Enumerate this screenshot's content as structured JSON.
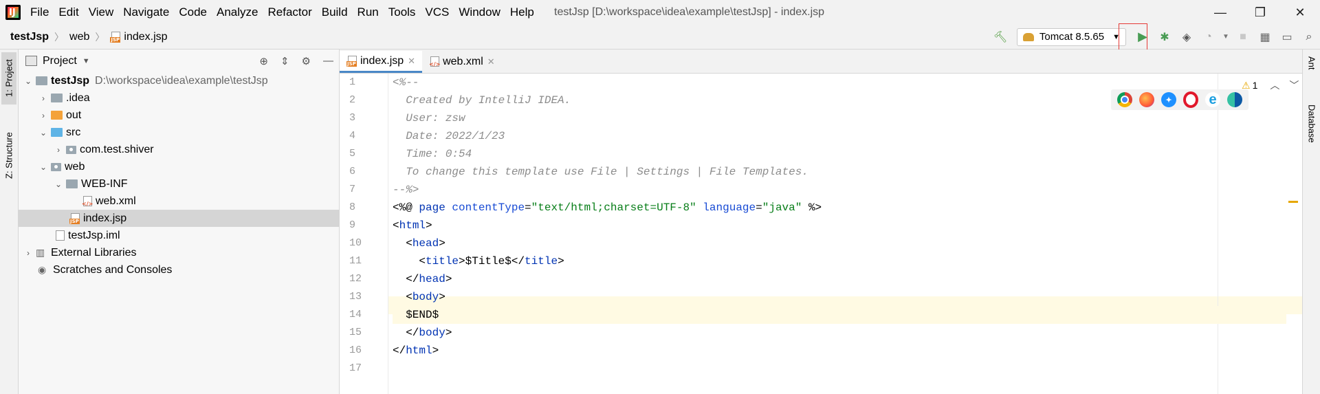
{
  "menubar": {
    "items": [
      "File",
      "Edit",
      "View",
      "Navigate",
      "Code",
      "Analyze",
      "Refactor",
      "Build",
      "Run",
      "Tools",
      "VCS",
      "Window",
      "Help"
    ],
    "window_title": "testJsp [D:\\workspace\\idea\\example\\testJsp] - index.jsp"
  },
  "navbar": {
    "breadcrumbs": [
      "testJsp",
      "web",
      "index.jsp"
    ],
    "run_config": "Tomcat 8.5.65"
  },
  "left_stripe": {
    "project_tab": "1: Project",
    "structure_tab": "Z: Structure"
  },
  "right_stripe": {
    "ant_tab": "Ant",
    "database_tab": "Database"
  },
  "project_panel": {
    "title": "Project",
    "tree": [
      {
        "label": "testJsp",
        "path": "D:\\workspace\\idea\\example\\testJsp"
      },
      {
        "label": ".idea"
      },
      {
        "label": "out"
      },
      {
        "label": "src"
      },
      {
        "label": "com.test.shiver"
      },
      {
        "label": "web"
      },
      {
        "label": "WEB-INF"
      },
      {
        "label": "web.xml"
      },
      {
        "label": "index.jsp"
      },
      {
        "label": "testJsp.iml"
      },
      {
        "label": "External Libraries"
      },
      {
        "label": "Scratches and Consoles"
      }
    ]
  },
  "editor": {
    "tabs": [
      "index.jsp",
      "web.xml"
    ],
    "warning_count": "1",
    "line_numbers": [
      "1",
      "2",
      "3",
      "4",
      "5",
      "6",
      "7",
      "8",
      "9",
      "10",
      "11",
      "12",
      "13",
      "14",
      "15",
      "16",
      "17"
    ],
    "code": {
      "l1": "<%--",
      "l2": "  Created by IntelliJ IDEA.",
      "l3": "  User: zsw",
      "l4": "  Date: 2022/1/23",
      "l5": "  Time: 0:54",
      "l6": "  To change this template use File | Settings | File Templates.",
      "l7": "--%>",
      "l8a": "<%@ ",
      "l8b": "page ",
      "l8c": "contentType",
      "l8d": "=",
      "l8e": "\"text/html;charset=UTF-8\"",
      "l8f": " language",
      "l8g": "=",
      "l8h": "\"java\"",
      "l8i": " %>",
      "l9a": "<",
      "l9b": "html",
      "l9c": ">",
      "l10a": "  <",
      "l10b": "head",
      "l10c": ">",
      "l11a": "    <",
      "l11b": "title",
      "l11c": ">$Title$</",
      "l11d": "title",
      "l11e": ">",
      "l12a": "  </",
      "l12b": "head",
      "l12c": ">",
      "l13a": "  <",
      "l13b": "body",
      "l13c": ">",
      "l14": "  $END$",
      "l15a": "  </",
      "l15b": "body",
      "l15c": ">",
      "l16a": "</",
      "l16b": "html",
      "l16c": ">",
      "l17": ""
    }
  }
}
